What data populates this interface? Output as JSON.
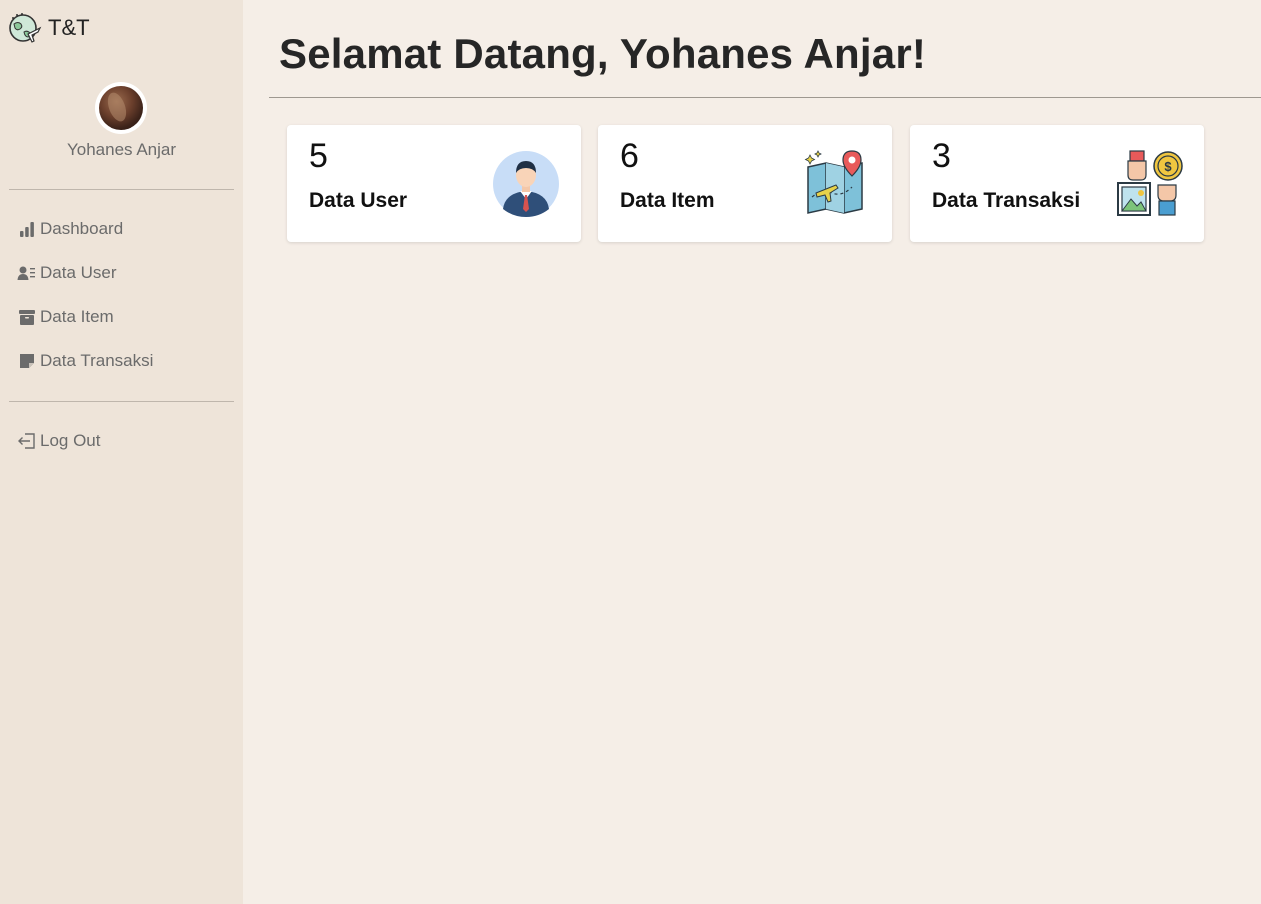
{
  "brand": {
    "name": "T&T",
    "icon": "globe-plane-icon"
  },
  "profile": {
    "name": "Yohanes Anjar",
    "avatar": "avatar"
  },
  "sidebar": {
    "items": [
      {
        "label": "Dashboard",
        "icon": "bar-chart-icon"
      },
      {
        "label": "Data User",
        "icon": "user-list-icon"
      },
      {
        "label": "Data Item",
        "icon": "box-icon"
      },
      {
        "label": "Data Transaksi",
        "icon": "note-icon"
      }
    ],
    "logout": {
      "label": "Log Out",
      "icon": "logout-icon"
    }
  },
  "main": {
    "title": "Selamat Datang, Yohanes Anjar!",
    "cards": [
      {
        "value": "5",
        "label": "Data User",
        "icon": "businessman-icon"
      },
      {
        "value": "6",
        "label": "Data Item",
        "icon": "travel-map-icon"
      },
      {
        "value": "3",
        "label": "Data Transaksi",
        "icon": "transaction-icon"
      }
    ]
  },
  "colors": {
    "sidebar_bg": "#eee4d9",
    "main_bg": "#f5eee7",
    "card_bg": "#ffffff",
    "text_muted": "#6b6b6b"
  }
}
